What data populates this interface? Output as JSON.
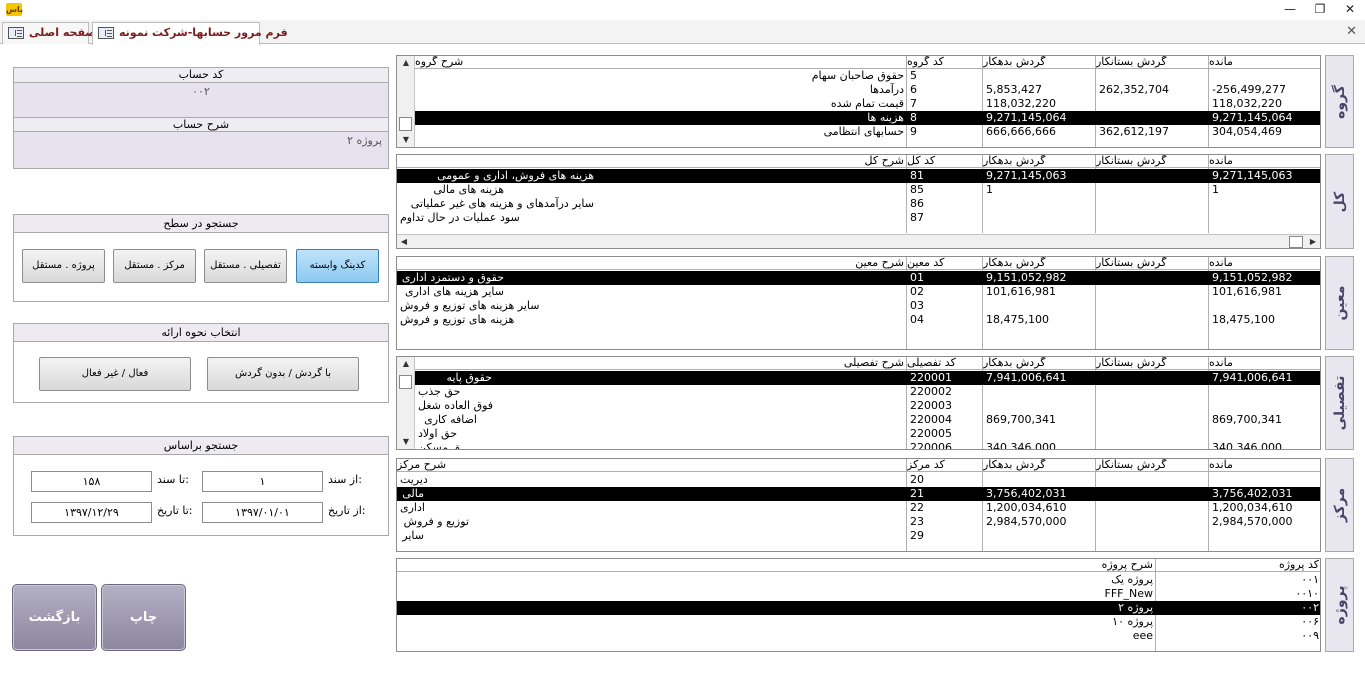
{
  "app": {
    "logo_text": "یاس",
    "win_min": "—",
    "win_restore": "❐",
    "win_close": "✕",
    "tab_close": "✕"
  },
  "tabs": [
    {
      "label": "صفحه اصلی"
    },
    {
      "label": "فرم مرور حسابها-شرکت نمونه"
    }
  ],
  "account": {
    "code_caption": "کد حساب",
    "code_value": "۰۰۲",
    "desc_caption": "شرح حساب",
    "desc_value": "پروژه ۲"
  },
  "level_search": {
    "caption": "جستجو در سطح",
    "buttons": [
      "کدینگ وابسته",
      "تفصیلی . مستقل",
      "مرکز . مستقل",
      "پروژه . مستقل"
    ]
  },
  "presentation": {
    "caption": "انتخاب نحوه ارائه",
    "buttons": [
      "با گردش / بدون گردش",
      "فعال / غیر فعال"
    ]
  },
  "search_by": {
    "caption": "جستجو  براساس",
    "from_doc_label": "از سند:",
    "from_doc_value": "۱",
    "to_doc_label": "تا سند:",
    "to_doc_value": "۱۵۸",
    "from_date_label": "از تاریخ:",
    "from_date_value": "۱۳۹۷/۰۱/۰۱",
    "to_date_label": "تا تاریخ:",
    "to_date_value": "۱۳۹۷/۱۲/۲۹"
  },
  "actions": {
    "print": "چاپ",
    "back": "بازگشت"
  },
  "grids": {
    "group": {
      "side": "گروه",
      "headers": {
        "desc": "شرح گروه",
        "code": "کد گروه",
        "debit": "گردش بدهکار",
        "credit": "گردش بستانکار",
        "balance": "مانده"
      },
      "rows": [
        {
          "desc": "حقوق صاحبان سهام",
          "code": "5",
          "debit": "",
          "credit": "",
          "balance": ""
        },
        {
          "desc": "درآمدها",
          "code": "6",
          "debit": "5,853,427",
          "credit": "262,352,704",
          "balance": "-256,499,277"
        },
        {
          "desc": "قیمت تمام شده",
          "code": "7",
          "debit": "118,032,220",
          "credit": "",
          "balance": "118,032,220"
        },
        {
          "desc": "هزینه ها",
          "code": "8",
          "debit": "9,271,145,064",
          "credit": "",
          "balance": "9,271,145,064"
        },
        {
          "desc": "حسابهای انتظامی",
          "code": "9",
          "debit": "666,666,666",
          "credit": "362,612,197",
          "balance": "304,054,469"
        }
      ]
    },
    "kol": {
      "side": "کل",
      "headers": {
        "desc": "شرح کل",
        "code": "کد کل",
        "debit": "گردش بدهکار",
        "credit": "گردش بستانکار",
        "balance": "مانده"
      },
      "rows": [
        {
          "desc": "هزینه های فروش،  اداری و عمومی",
          "code": "81",
          "debit": "9,271,145,063",
          "credit": "",
          "balance": "9,271,145,063"
        },
        {
          "desc": "هزینه های مالی",
          "code": "85",
          "debit": "1",
          "credit": "",
          "balance": "1"
        },
        {
          "desc": "سایر درآمدهای و هزینه های غیر عملیاتی",
          "code": "86",
          "debit": "",
          "credit": "",
          "balance": ""
        },
        {
          "desc": "سود عملیات در حال تداوم",
          "code": "87",
          "debit": "",
          "credit": "",
          "balance": ""
        }
      ]
    },
    "moein": {
      "side": "معین",
      "headers": {
        "desc": "شرح معین",
        "code": "کد معین",
        "debit": "گردش بدهکار",
        "credit": "گردش بستانکار",
        "balance": "مانده"
      },
      "rows": [
        {
          "desc": "حقوق و دستمزد اداری",
          "code": "01",
          "debit": "9,151,052,982",
          "credit": "",
          "balance": "9,151,052,982"
        },
        {
          "desc": "سایر هزینه های اداری",
          "code": "02",
          "debit": "101,616,981",
          "credit": "",
          "balance": "101,616,981"
        },
        {
          "desc": "سایر هزینه های توزیع و فروش",
          "code": "03",
          "debit": "",
          "credit": "",
          "balance": ""
        },
        {
          "desc": "هزینه های توزیع و فروش",
          "code": "04",
          "debit": "18,475,100",
          "credit": "",
          "balance": "18,475,100"
        }
      ]
    },
    "tafsili": {
      "side": "تفصیلی",
      "headers": {
        "desc": "شرح تفصیلی",
        "code": "کد تفصیلی",
        "debit": "گردش بدهکار",
        "credit": "گردش بستانکار",
        "balance": "مانده"
      },
      "rows": [
        {
          "desc": "حقوق پایه",
          "code": "220001",
          "debit": "7,941,006,641",
          "credit": "",
          "balance": "7,941,006,641"
        },
        {
          "desc": "حق جذب",
          "code": "220002",
          "debit": "",
          "credit": "",
          "balance": ""
        },
        {
          "desc": "فوق العاده شغل",
          "code": "220003",
          "debit": "",
          "credit": "",
          "balance": ""
        },
        {
          "desc": "اضافه کاری",
          "code": "220004",
          "debit": "869,700,341",
          "credit": "",
          "balance": "869,700,341"
        },
        {
          "desc": "حق اولاد",
          "code": "220005",
          "debit": "",
          "credit": "",
          "balance": ""
        },
        {
          "desc": "حق مسکن",
          "code": "220006",
          "debit": "340,346,000",
          "credit": "",
          "balance": "340,346,000"
        }
      ]
    },
    "markaz": {
      "side": "مرکز",
      "headers": {
        "desc": "شرح مرکز",
        "code": "کد مرکز",
        "debit": "گردش بدهکار",
        "credit": "گردش بستانکار",
        "balance": "مانده"
      },
      "rows": [
        {
          "desc": "مدیریت",
          "code": "20",
          "debit": "",
          "credit": "",
          "balance": ""
        },
        {
          "desc": "مالی",
          "code": "21",
          "debit": "3,756,402,031",
          "credit": "",
          "balance": "3,756,402,031"
        },
        {
          "desc": "اداری",
          "code": "22",
          "debit": "1,200,034,610",
          "credit": "",
          "balance": "1,200,034,610"
        },
        {
          "desc": "توزیع و فروش",
          "code": "23",
          "debit": "2,984,570,000",
          "credit": "",
          "balance": "2,984,570,000"
        },
        {
          "desc": "سایر",
          "code": "29",
          "debit": "",
          "credit": "",
          "balance": ""
        }
      ]
    },
    "project": {
      "side": "پروژه",
      "headers": {
        "desc": "شرح پروژه",
        "code": "کد پروژه"
      },
      "rows": [
        {
          "desc": "پروژه یک",
          "code": "۰۰۱"
        },
        {
          "desc": "FFF_New",
          "code": "۰۰۱۰"
        },
        {
          "desc": "پروژه ۲",
          "code": "۰۰۲"
        },
        {
          "desc": "پروژه ۱۰",
          "code": "۰۰۶"
        },
        {
          "desc": "eee",
          "code": "۰۰۹"
        }
      ]
    }
  }
}
